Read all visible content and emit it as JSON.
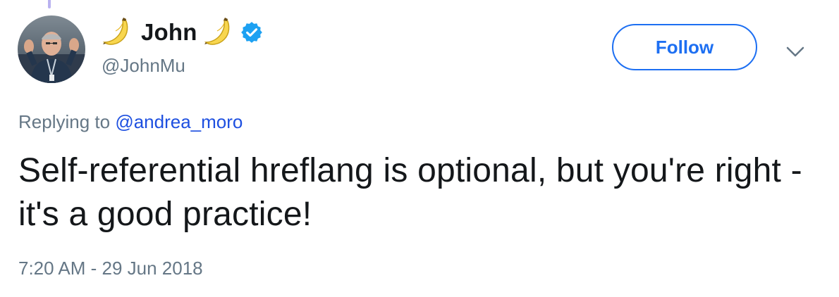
{
  "tweet": {
    "author": {
      "display_name": "John",
      "handle": "@JohnMu",
      "verified": true,
      "name_emoji": "banana-icon"
    },
    "follow_label": "Follow",
    "menu_icon": "chevron-down-icon",
    "reply_prefix": "Replying to",
    "reply_to": "@andrea_moro",
    "text": "Self-referential hreflang is optional, but you're right - it's a good practice!",
    "timestamp": "7:20 AM - 29 Jun 2018"
  },
  "colors": {
    "accent": "#1d6ff2",
    "mention": "#1d4fe0",
    "muted": "#657786",
    "text": "#14171a",
    "verified": "#1da1f2",
    "thread_line": "#b9b2f0"
  }
}
